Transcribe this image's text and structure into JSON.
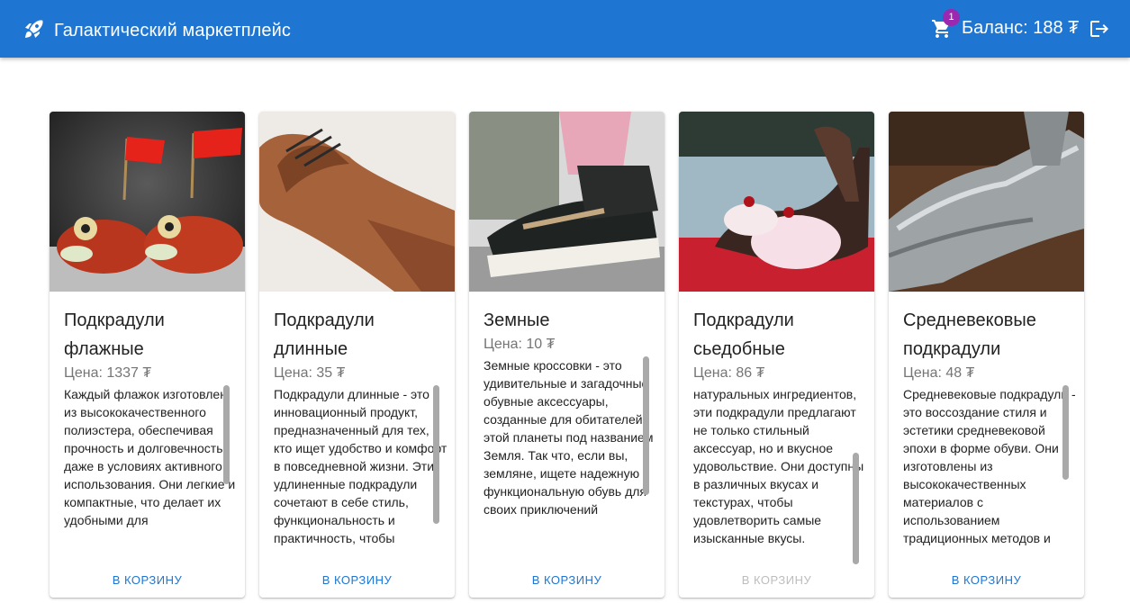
{
  "header": {
    "title": "Галактический маркетплейс",
    "cart_count": "1",
    "balance": "Баланс: 188 ₮",
    "colors": {
      "bar": "#1e76d2",
      "badge": "#9c27b0"
    }
  },
  "products": [
    {
      "title": "Подкрадули флажные",
      "price": "Цена: 1337 ₮",
      "description": "Каждый флажок изготовлен из высококачественного полиэстера, обеспечивая прочность и долговечность даже в условиях активного использования. Они легкие и компактные, что делает их удобными для",
      "button": "В корзину",
      "button_enabled": true,
      "image": "red-fish-shoes-with-flags"
    },
    {
      "title": "Подкрадули длинные",
      "price": "Цена: 35 ₮",
      "description": "Подкрадули длинные - это инновационный продукт, предназначенный для тех, кто ищет удобство и комфорт в повседневной жизни. Эти удлиненные подкрадули сочетают в себе стиль, функциональность и практичность, чтобы",
      "button": "В корзину",
      "button_enabled": true,
      "image": "long-brown-leather-shoe"
    },
    {
      "title": "Земные",
      "price": "Цена: 10 ₮",
      "description": "Земные кроссовки - это удивительные и загадочные обувные аксессуары, созданные для обитателей этой планеты под названием Земля. Так что, если вы, земляне, ищете надежную и функциональную обувь для своих приключений",
      "button": "В корзину",
      "button_enabled": true,
      "image": "sneakers-on-feet"
    },
    {
      "title": "Подкрадули сьедобные",
      "price": "Цена: 86 ₮",
      "description": "натуральных ингредиентов, эти подкрадули предлагают не только стильный аксессуар, но и вкусное удовольствие. Они доступны в различных вкусах и текстурах, чтобы удовлетворить самые изысканные вкусы.",
      "button": "В корзину",
      "button_enabled": false,
      "image": "ice-cream-high-heels"
    },
    {
      "title": "Средневековые подкрадули",
      "price": "Цена: 48 ₮",
      "description": "Средневековые подкрадули - это воссоздание стиля и эстетики средневековой эпохи в форме обуви. Они изготовлены из высококачественных материалов с использованием традиционных методов и",
      "button": "В корзину",
      "button_enabled": true,
      "image": "silver-armor-boots"
    }
  ]
}
